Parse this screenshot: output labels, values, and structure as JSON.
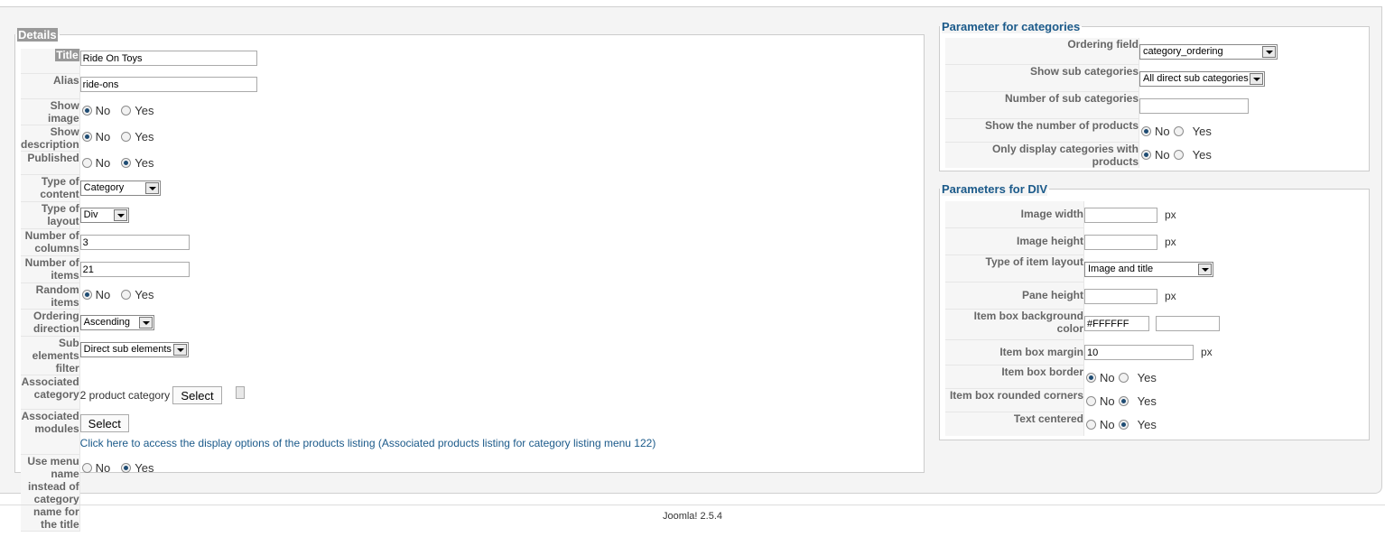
{
  "details": {
    "legend": "Details",
    "fields": {
      "title_label": "Title",
      "title_value": "Ride On Toys",
      "alias_label": "Alias",
      "alias_value": "ride-ons",
      "show_image_label": "Show image",
      "show_description_label": "Show description",
      "published_label": "Published",
      "type_content_label": "Type of content",
      "type_content_value": "Category",
      "type_layout_label": "Type of layout",
      "type_layout_value": "Div",
      "num_columns_label": "Number of columns",
      "num_columns_value": "3",
      "num_items_label": "Number of items",
      "num_items_value": "21",
      "random_items_label": "Random items",
      "ordering_direction_label": "Ordering direction",
      "ordering_direction_value": "Ascending",
      "sub_elements_label": "Sub elements filter",
      "sub_elements_value": "Direct sub elements",
      "assoc_category_label": "Associated category",
      "assoc_category_value": "2 product category",
      "assoc_category_button": "Select",
      "assoc_modules_label": "Associated modules",
      "assoc_modules_button": "Select",
      "products_link": "Click here to access the display options of the products listing (Associated products listing for category listing menu 122)",
      "menu_name_label_1": "Use menu name instead of",
      "menu_name_label_2": "category name for the title"
    },
    "radio_no": "No",
    "radio_yes": "Yes",
    "radio_states": {
      "show_image": "No",
      "show_description": "No",
      "published": "Yes",
      "random_items": "No",
      "use_menu_name": "Yes"
    }
  },
  "categories": {
    "legend": "Parameter for categories",
    "ordering_field_label": "Ordering field",
    "ordering_field_value": "category_ordering",
    "show_sub_label": "Show sub categories",
    "show_sub_value": "All direct sub categories",
    "num_sub_label": "Number of sub categories",
    "num_sub_value": "",
    "show_num_products_label": "Show the number of products",
    "only_display_label": "Only display categories with products",
    "radio_states": {
      "show_num_products": "No",
      "only_display": "No"
    }
  },
  "div_params": {
    "legend": "Parameters for DIV",
    "image_width_label": "Image width",
    "image_width_value": "",
    "image_height_label": "Image height",
    "image_height_value": "",
    "unit_px": "px",
    "item_layout_label": "Type of item layout",
    "item_layout_value": "Image and title",
    "pane_height_label": "Pane height",
    "pane_height_value": "",
    "bg_color_label": "Item box background color",
    "bg_color_value": "#FFFFFF",
    "bg_color_swatch": "",
    "margin_label": "Item box margin",
    "margin_value": "10",
    "border_label": "Item box border",
    "rounded_label": "Item box rounded corners",
    "centered_label": "Text centered",
    "radio_states": {
      "border": "No",
      "rounded": "Yes",
      "centered": "Yes"
    }
  },
  "footer": {
    "text": "Joomla! 2.5.4"
  }
}
